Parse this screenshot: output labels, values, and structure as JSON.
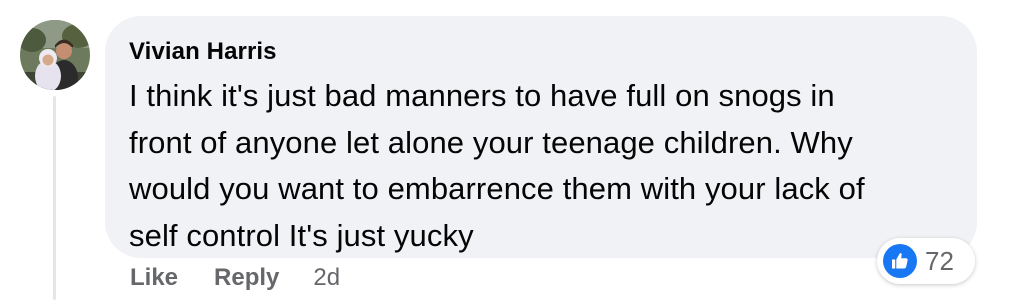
{
  "comment": {
    "author": "Vivian Harris",
    "text": "I think it's just bad manners to have full on snogs in\nfront of anyone let alone your teenage children. Why\nwould you want to embarrence them with your lack of\nself control It's just yucky",
    "reaction_count": "72"
  },
  "actions": {
    "like_label": "Like",
    "reply_label": "Reply",
    "timestamp": "2d"
  },
  "colors": {
    "bubble": "#f0f2f5",
    "like_blue": "#1877f2",
    "secondary_text": "#65676b",
    "primary_text": "#050505"
  },
  "icons": {
    "avatar": "avatar-photo",
    "reaction": "thumbs-up-icon"
  }
}
